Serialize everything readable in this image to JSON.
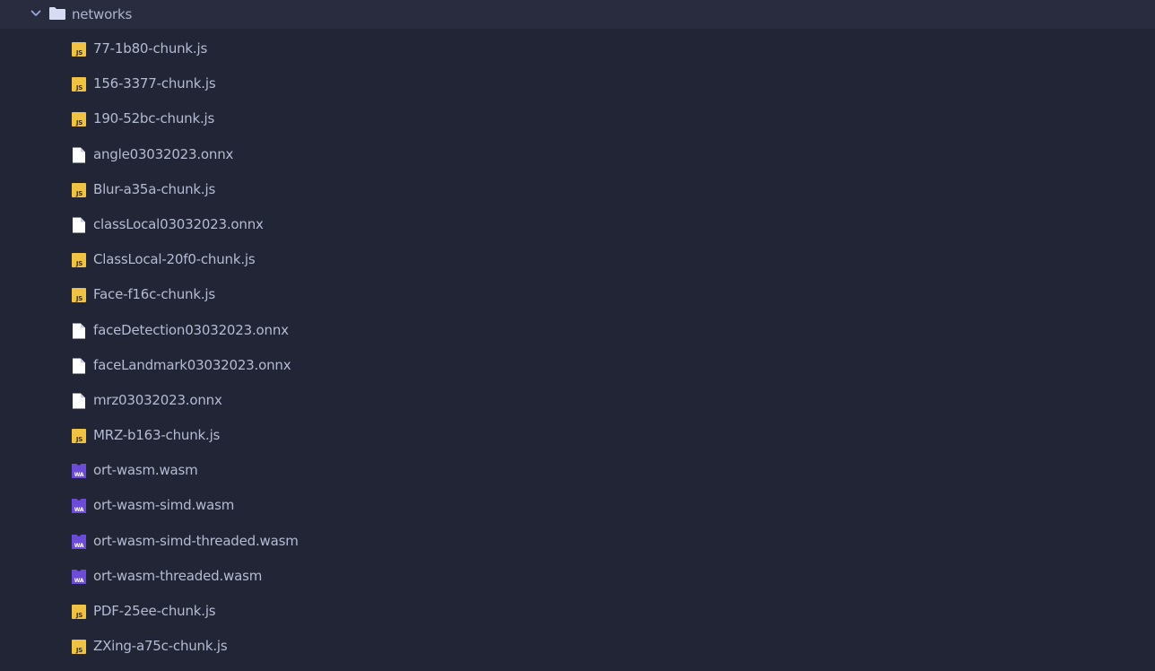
{
  "folder": {
    "name": "networks",
    "expanded": true,
    "icon": "folder-icon",
    "chevron_icon": "chevron-down-icon"
  },
  "colors": {
    "background": "#222535",
    "folder_row_bg": "#292c3e",
    "text": "#b5bbd2",
    "js_icon": "#f0c243",
    "wasm_icon": "#6c4bd8",
    "file_icon": "#ffffff",
    "folder_icon": "#d7dcf3"
  },
  "files": [
    {
      "name": "77-1b80-chunk.js",
      "icon": "js-file-icon"
    },
    {
      "name": "156-3377-chunk.js",
      "icon": "js-file-icon"
    },
    {
      "name": "190-52bc-chunk.js",
      "icon": "js-file-icon"
    },
    {
      "name": "angle03032023.onnx",
      "icon": "generic-file-icon"
    },
    {
      "name": "Blur-a35a-chunk.js",
      "icon": "js-file-icon"
    },
    {
      "name": "classLocal03032023.onnx",
      "icon": "generic-file-icon"
    },
    {
      "name": "ClassLocal-20f0-chunk.js",
      "icon": "js-file-icon"
    },
    {
      "name": "Face-f16c-chunk.js",
      "icon": "js-file-icon"
    },
    {
      "name": "faceDetection03032023.onnx",
      "icon": "generic-file-icon"
    },
    {
      "name": "faceLandmark03032023.onnx",
      "icon": "generic-file-icon"
    },
    {
      "name": "mrz03032023.onnx",
      "icon": "generic-file-icon"
    },
    {
      "name": "MRZ-b163-chunk.js",
      "icon": "js-file-icon"
    },
    {
      "name": "ort-wasm.wasm",
      "icon": "wasm-file-icon"
    },
    {
      "name": "ort-wasm-simd.wasm",
      "icon": "wasm-file-icon"
    },
    {
      "name": "ort-wasm-simd-threaded.wasm",
      "icon": "wasm-file-icon"
    },
    {
      "name": "ort-wasm-threaded.wasm",
      "icon": "wasm-file-icon"
    },
    {
      "name": "PDF-25ee-chunk.js",
      "icon": "js-file-icon"
    },
    {
      "name": "ZXing-a75c-chunk.js",
      "icon": "js-file-icon"
    }
  ]
}
